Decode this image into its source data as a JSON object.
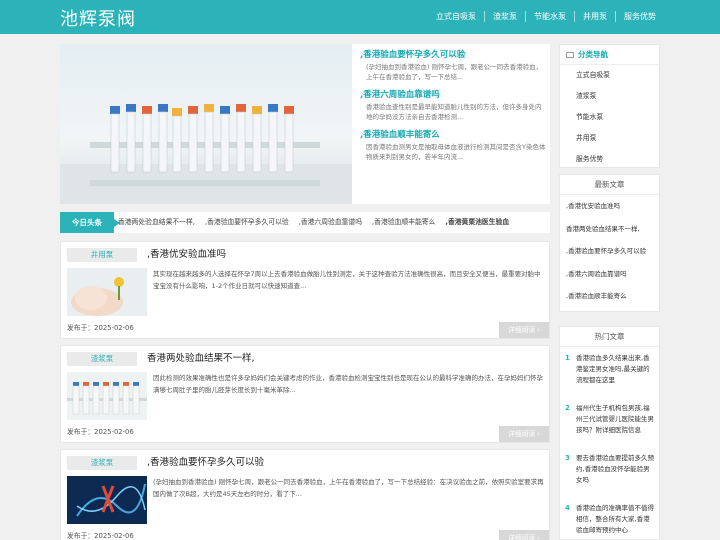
{
  "header": {
    "logo": "池辉泵阀",
    "nav": [
      "立式自吸泵",
      "渣浆泵",
      "节能水泵",
      "井用泵",
      "服务优势"
    ]
  },
  "hero": {
    "items": [
      {
        "title": ",香港验血要怀孕多久可以验",
        "desc": "(孕妇抽血到香港验血) 刚怀孕七周，跟老公一同去香港验血，上午在香港验血了，写一下总结..."
      },
      {
        "title": ",香港六周验血靠谱吗",
        "desc": "香港验血查性别是最早能知道胎儿性别的方法，但许多身处内地的孕妈没方法亲自去香港检测..."
      },
      {
        "title": ",香港验血顺丰能寄么",
        "desc": "因香港验血测男女是抽取母体血液进行检测其间是否含Y染色体物质来判别男女的，若半年内流..."
      }
    ]
  },
  "ticker": {
    "label": "今日头条",
    "items": [
      "香港两处验血结果不一样,",
      ",香港验血要怀孕多久可以验",
      ",香港六周验血靠谱吗",
      ",香港验血顺丰能寄么",
      ",香港黄栗池医生验血"
    ]
  },
  "articles": [
    {
      "category": "井用泵",
      "title": ",香港优安验血准吗",
      "desc": "其实现在越来越多的人选择在怀孕7周以上去香港验血做胎儿性别测定，关于这种查验方法准确性很高，而且安全又便当，最重要对胎中宝宝没有什么影响，1-2个作业日就可以快速知道查...",
      "date": "发布于：2025-02-06",
      "more": "详细阅读 ›"
    },
    {
      "category": "渣浆泵",
      "title": "香港两处验血结果不一样,",
      "desc": "因此检测的效果准确性也是许多孕妈妈们会关键考虑的作业，香港验血检测宝宝性别也是现在公认的最科学准确的办法，在孕妈妈们怀孕满够七周肚子里的胎儿胚芽长度长到十毫米革除...",
      "date": "发布于：2025-02-06",
      "more": "详细阅读 ›"
    },
    {
      "category": "渣浆泵",
      "title": ",香港验血要怀孕多久可以验",
      "desc": "(孕妇抽血到香港验血) 刚怀孕七周，跟老公一同去香港验血，上午在香港验血了，写一下总结经验：在决议验血之前，依照实验室要求再国内做了次B超，大约是45天左右的时分，看了下...",
      "date": "发布于：2025-02-06",
      "more": "详细阅读 ›"
    }
  ],
  "sidebar": {
    "cat_head": "分类导航",
    "cats": [
      "立式自吸泵",
      "渣浆泵",
      "节能水泵",
      "井用泵",
      "服务优势"
    ],
    "latest_head": "最新文章",
    "latest": [
      ",香港优安验血准吗",
      "香港两处验血结果不一样,",
      ",香港验血要怀孕多久可以验",
      ",香港六周验血靠谱吗",
      ",香港验血顺丰能寄么"
    ],
    "hot_head": "热门文章",
    "hot": [
      {
        "num": "1",
        "text": "香港验血多久结果出来,香港鉴定男女准吗,最关键的流程都在这里"
      },
      {
        "num": "2",
        "text": "福州代生子机构包男孩,福州三代试管婴儿医院能生男孩吗？附详细医院信息"
      },
      {
        "num": "3",
        "text": "要去香港验血要提前多久预约,香港验血没怀孕能验男女吗"
      },
      {
        "num": "4",
        "text": "香港验血的准确率值不值得相信，整合所有大家,香港验血邮寄预约中心"
      }
    ]
  },
  "colors": {
    "accent": "#2bb3b9",
    "accent_text": "#16a9b0"
  }
}
